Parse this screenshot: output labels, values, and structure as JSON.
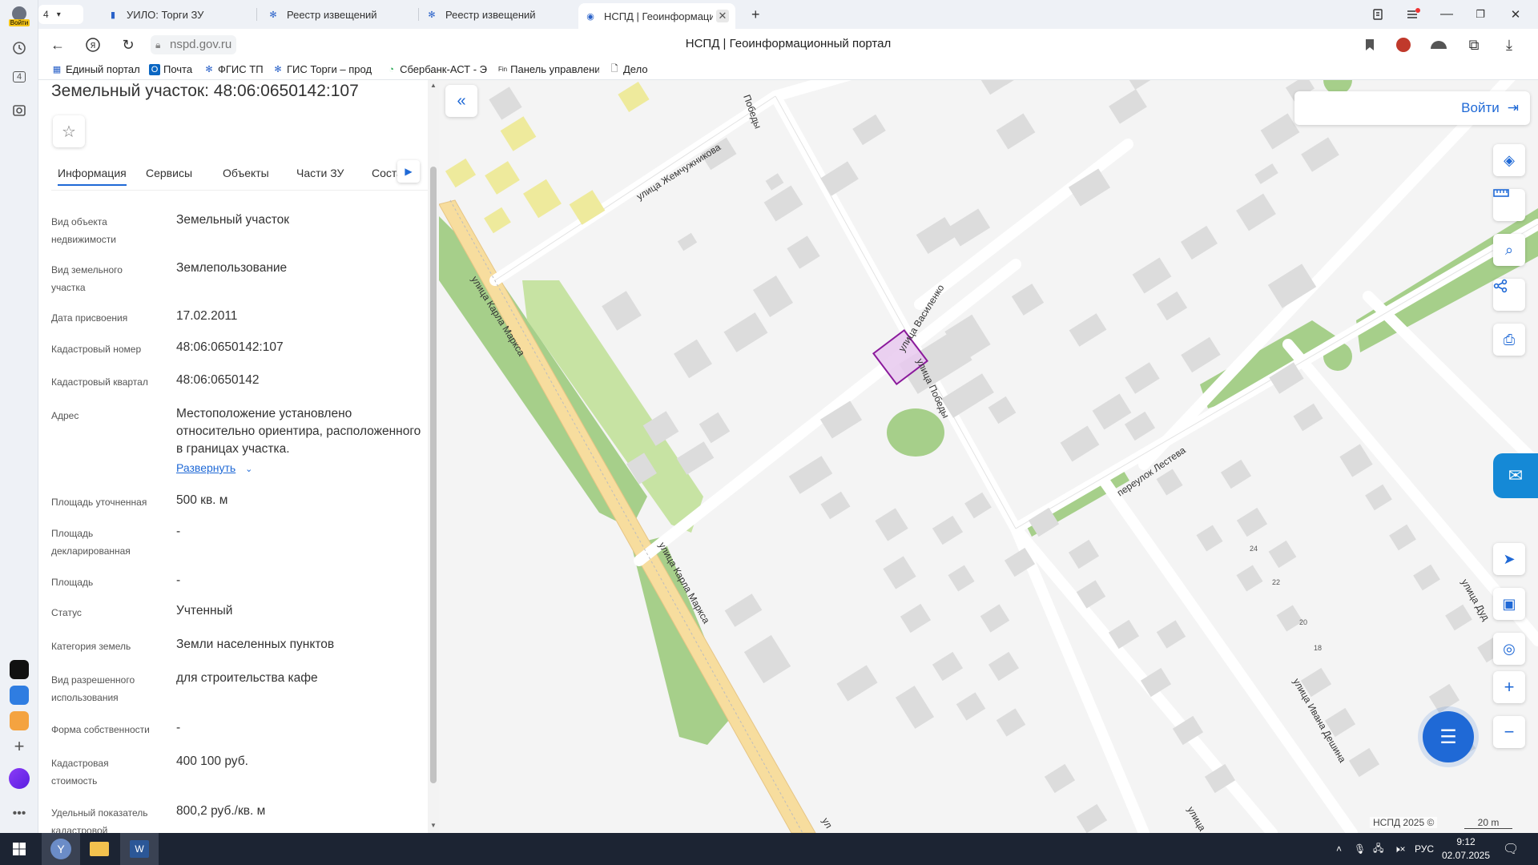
{
  "browser": {
    "rail": {
      "login_label": "Войти",
      "tab_count": "4"
    },
    "tabs": [
      {
        "label": "УИЛО: Торги ЗУ",
        "active": false
      },
      {
        "label": "Реестр извещений",
        "active": false
      },
      {
        "label": "Реестр извещений",
        "active": false
      },
      {
        "label": "НСПД | Геоинформаци",
        "active": true
      }
    ],
    "tab_count_badge": "4",
    "url": "nspd.gov.ru",
    "page_title": "НСПД | Геоинформационный портал",
    "bookmarks": [
      {
        "label": "Единый портал",
        "icon": "portal-icon"
      },
      {
        "label": "Почта",
        "icon": "mail-icon"
      },
      {
        "label": "ФГИС ТП",
        "icon": "emblem-icon"
      },
      {
        "label": "ГИС Торги – прод",
        "icon": "emblem-icon"
      },
      {
        "label": "Сбербанк-АСТ - Э",
        "icon": "sber-icon"
      },
      {
        "label": "Панель управлени",
        "icon": "fin-icon"
      },
      {
        "label": "Дело",
        "icon": "document-icon"
      }
    ]
  },
  "panel": {
    "title": "Земельный участок: 48:06:0650142:107",
    "tabs": [
      "Информация",
      "Сервисы",
      "Объекты",
      "Части ЗУ",
      "Соста"
    ],
    "active_tab": "Информация",
    "expand_label": "Развернуть",
    "rows": [
      {
        "label": "Вид объекта недвижимости",
        "value": "Земельный участок"
      },
      {
        "label": "Вид земельного участка",
        "value": "Землепользование"
      },
      {
        "label": "Дата присвоения",
        "value": "17.02.2011"
      },
      {
        "label": "Кадастровый номер",
        "value": "48:06:0650142:107"
      },
      {
        "label": "Кадастровый квартал",
        "value": "48:06:0650142"
      },
      {
        "label": "Адрес",
        "value": "Местоположение установлено относительно ориентира, расположенного в границах участка."
      },
      {
        "label": "Площадь уточненная",
        "value": "500 кв. м"
      },
      {
        "label": "Площадь декларированная",
        "value": "-"
      },
      {
        "label": "Площадь",
        "value": "-"
      },
      {
        "label": "Статус",
        "value": "Учтенный"
      },
      {
        "label": "Категория земель",
        "value": "Земли населенных пунктов"
      },
      {
        "label": "Вид разрешенного использования",
        "value": "для строительства кафе"
      },
      {
        "label": "Форма собственности",
        "value": "-"
      },
      {
        "label": "Кадастровая стоимость",
        "value": "400 100 руб."
      },
      {
        "label": "Удельный показатель кадастровой",
        "value": "800,2 руб./кв. м"
      }
    ]
  },
  "map": {
    "login_label": "Войти",
    "attribution": "НСПД 2025 ©",
    "scale": "20 m",
    "streets": {
      "zhemchuzhnikova": "улица Жемчужникова",
      "pobedy_top": "Победы",
      "karla_marksa_1": "улица Карла Маркса",
      "karla_marksa_2": "улица Карла Маркса",
      "vasilenko": "улица Василенко",
      "pobedy": "улица Победы",
      "lesteva": "переулок Лестева",
      "ivana_deshina": "улица Ивана Дешина",
      "dud": "улица Дуд",
      "ulitsa": "улица",
      "ul": "ул"
    },
    "house_numbers": [
      "24",
      "22",
      "20",
      "18"
    ],
    "colors": {
      "parcel_fill": "#e8c9ee",
      "parcel_stroke": "#8b1a9c",
      "road": "#f7dd9e",
      "green": "#a6cf8a",
      "building": "#dcdcdc",
      "yellow_building": "#eeea9c"
    }
  },
  "taskbar": {
    "language": "РУС",
    "time": "9:12",
    "date": "02.07.2025"
  }
}
